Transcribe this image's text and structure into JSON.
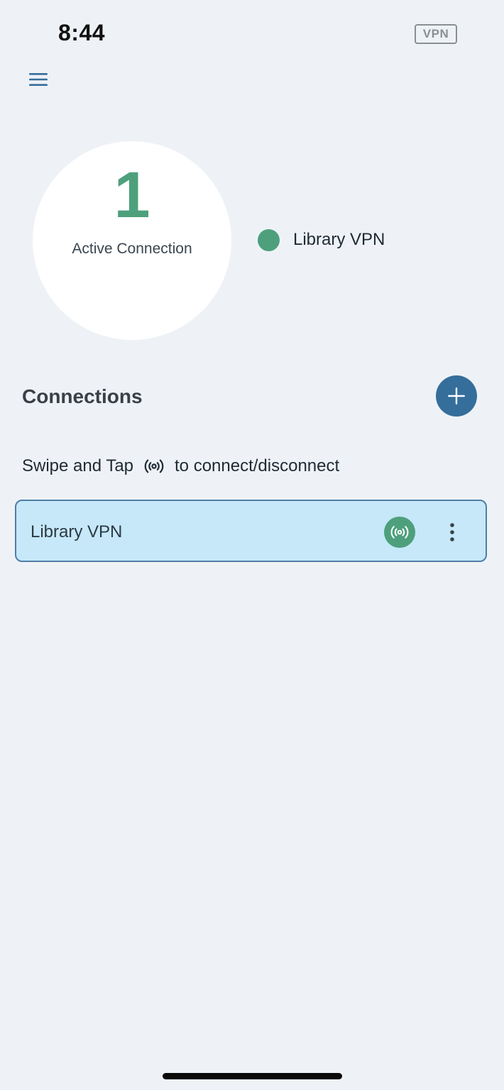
{
  "status_bar": {
    "time": "8:44",
    "vpn_badge": "VPN"
  },
  "summary": {
    "active_count": "1",
    "active_label": "Active Connection",
    "active_connections": [
      {
        "name": "Library VPN",
        "status_color": "#4ea07c"
      }
    ]
  },
  "connections": {
    "title": "Connections",
    "hint_before": "Swipe and Tap",
    "hint_after": "to connect/disconnect",
    "items": [
      {
        "name": "Library VPN",
        "connected": true
      }
    ]
  },
  "colors": {
    "accent": "#356e9b",
    "connected": "#4ea07c",
    "card_bg": "#c6e8f9",
    "page_bg": "#eef2f6"
  },
  "icons": {
    "menu": "hamburger-menu-icon",
    "add": "plus-icon",
    "broadcast": "broadcast-icon",
    "more": "more-vertical-icon"
  }
}
